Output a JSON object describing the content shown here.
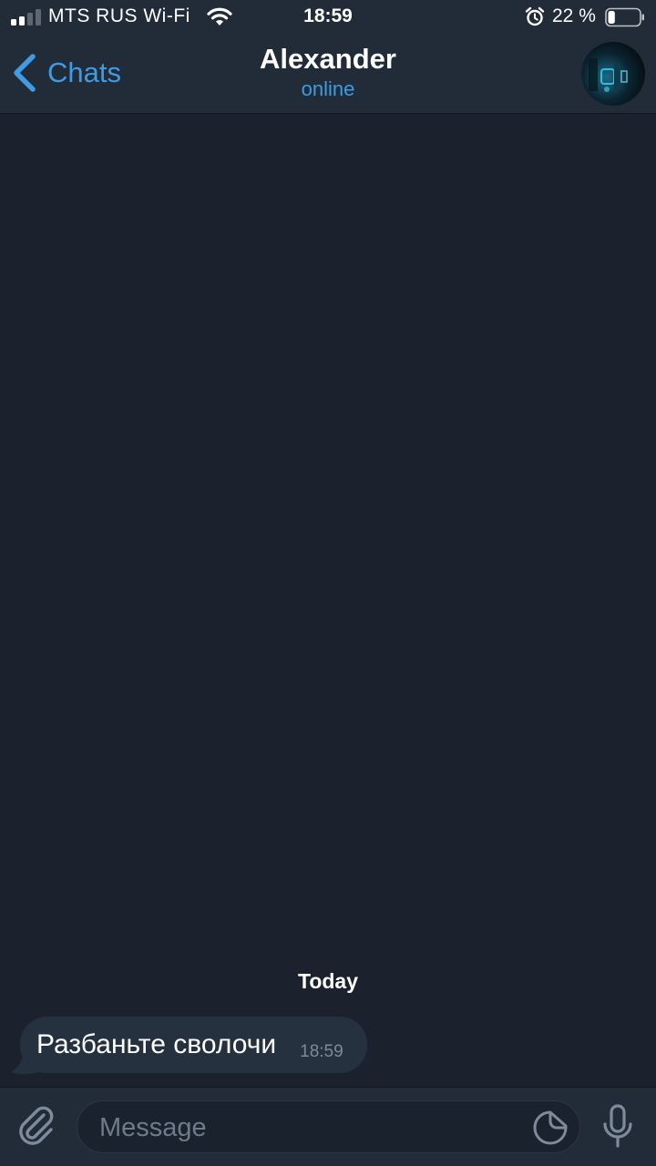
{
  "status_bar": {
    "carrier": "MTS RUS Wi-Fi",
    "time": "18:59",
    "battery_percent": "22 %",
    "battery_level": 0.22
  },
  "nav": {
    "back_label": "Chats",
    "title": "Alexander",
    "subtitle": "online"
  },
  "chat": {
    "date_separator": "Today",
    "messages": [
      {
        "text": "Разбаньте сволочи",
        "time": "18:59",
        "direction": "incoming"
      }
    ]
  },
  "input": {
    "placeholder": "Message"
  },
  "colors": {
    "accent": "#3e9be6",
    "background": "#1b222d",
    "bar": "#222c38",
    "bubble": "#263140"
  }
}
